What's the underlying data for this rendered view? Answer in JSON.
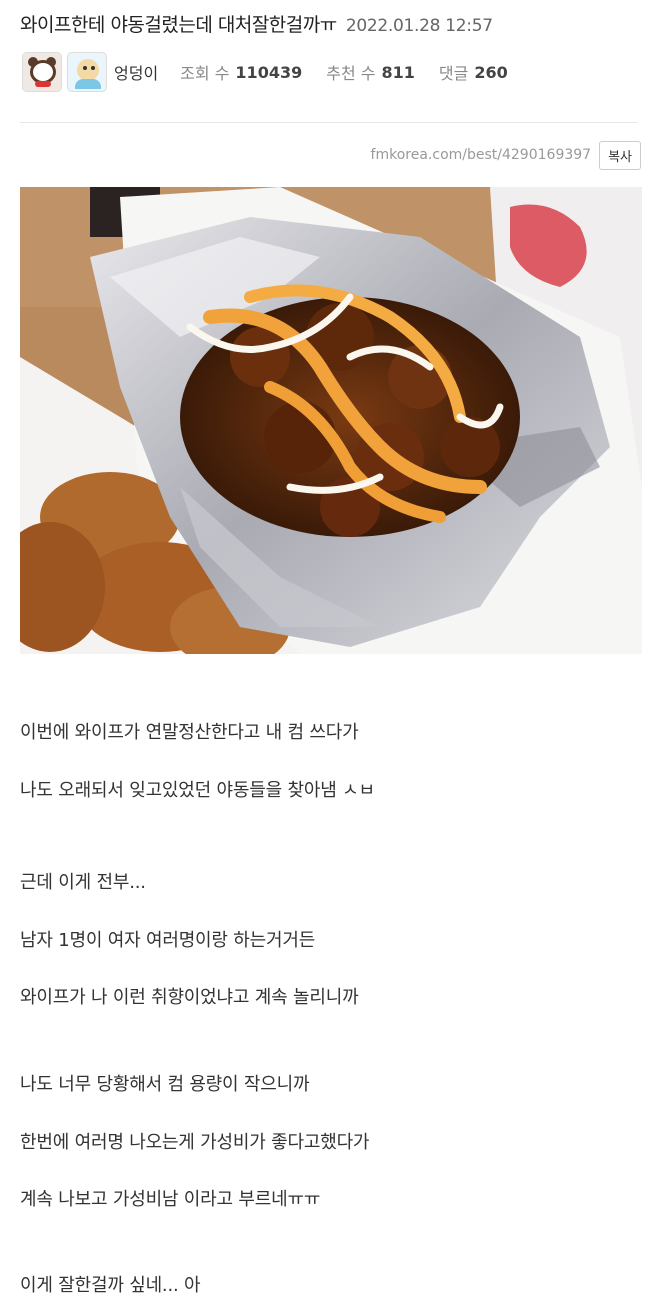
{
  "post": {
    "title": "와이프한테 야동걸렸는데 대처잘한걸까ㅠ",
    "date": "2022.01.28 12:57",
    "author": "엉덩이",
    "views_label": "조회 수",
    "views": "110439",
    "recommend_label": "추천 수",
    "recommends": "811",
    "comments_label": "댓글",
    "comments": "260",
    "url": "fmkorea.com/best/4290169397",
    "copy_label": "복사"
  },
  "photo": {
    "description_icon": "fried-chicken-photo"
  },
  "content": {
    "lines": [
      "이번에 와이프가 연말정산한다고 내 컴 쓰다가",
      "나도 오래되서 잊고있었던 야동들을 찾아냄 ㅅㅂ",
      "근데 이게 전부...",
      "남자 1명이 여자 여러명이랑 하는거거든",
      "와이프가 나 이런 취향이었냐고 계속 놀리니까",
      "나도 너무 당황해서 컴 용량이 작으니까",
      "한번에 여러명 나오는게 가성비가 좋다고했다가",
      "계속 나보고 가성비남 이라고 부르네ㅠㅠ",
      "이게 잘한걸까 싶네... 아"
    ]
  }
}
